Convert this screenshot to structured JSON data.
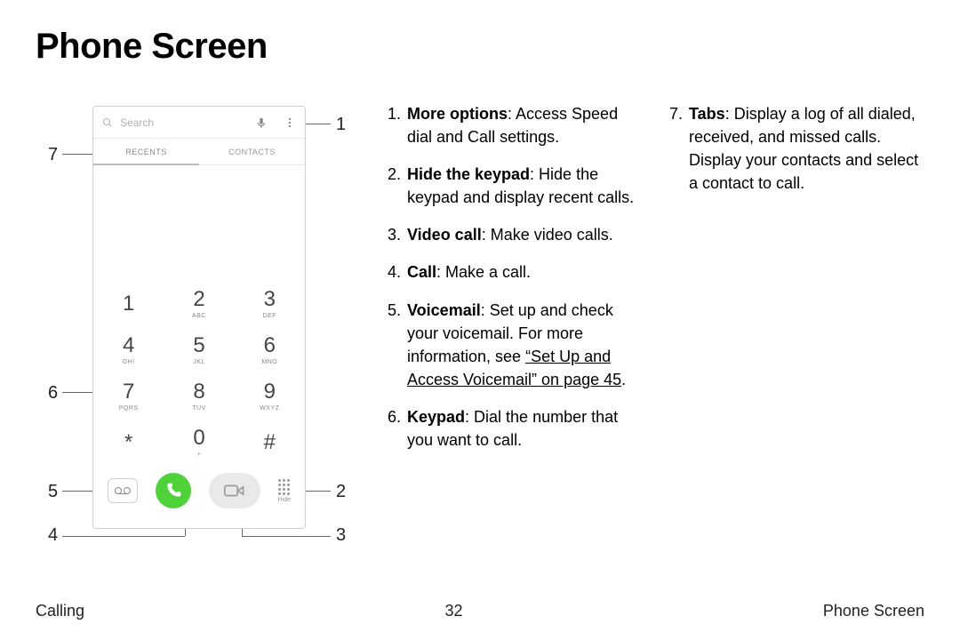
{
  "title": "Phone Screen",
  "phone": {
    "search_placeholder": "Search",
    "tab_recents": "RECENTS",
    "tab_contacts": "CONTACTS",
    "keys": [
      {
        "d": "1",
        "l": ""
      },
      {
        "d": "2",
        "l": "ABC"
      },
      {
        "d": "3",
        "l": "DEF"
      },
      {
        "d": "4",
        "l": "GHI"
      },
      {
        "d": "5",
        "l": "JKL"
      },
      {
        "d": "6",
        "l": "MNO"
      },
      {
        "d": "7",
        "l": "PQRS"
      },
      {
        "d": "8",
        "l": "TUV"
      },
      {
        "d": "9",
        "l": "WXYZ"
      },
      {
        "d": "*",
        "l": ""
      },
      {
        "d": "0",
        "l": "+"
      },
      {
        "d": "#",
        "l": ""
      }
    ],
    "hide_label": "Hide"
  },
  "callouts": {
    "c1": "1",
    "c2": "2",
    "c3": "3",
    "c4": "4",
    "c5": "5",
    "c6": "6",
    "c7": "7"
  },
  "list": {
    "i1": {
      "n": "1.",
      "b": "More options",
      "t": ": Access Speed dial and Call settings."
    },
    "i2": {
      "n": "2.",
      "b": "Hide the keypad",
      "t": ": Hide the keypad and display recent calls."
    },
    "i3": {
      "n": "3.",
      "b": "Video call",
      "t": ": Make video calls."
    },
    "i4": {
      "n": "4.",
      "b": "Call",
      "t": ": Make a call."
    },
    "i5": {
      "n": "5.",
      "b": "Voicemail",
      "t": ": Set up and check your voicemail. For more information, see ",
      "link": "“Set Up and Access Voicemail” on page 45",
      "t2": "."
    },
    "i6": {
      "n": "6.",
      "b": "Keypad",
      "t": ": Dial the number that you want to call."
    },
    "i7": {
      "n": "7.",
      "b": "Tabs",
      "t": ": Display a log of all dialed, received, and missed calls. Display your contacts and select a contact to call."
    }
  },
  "footer": {
    "left": "Calling",
    "center": "32",
    "right": "Phone Screen"
  }
}
